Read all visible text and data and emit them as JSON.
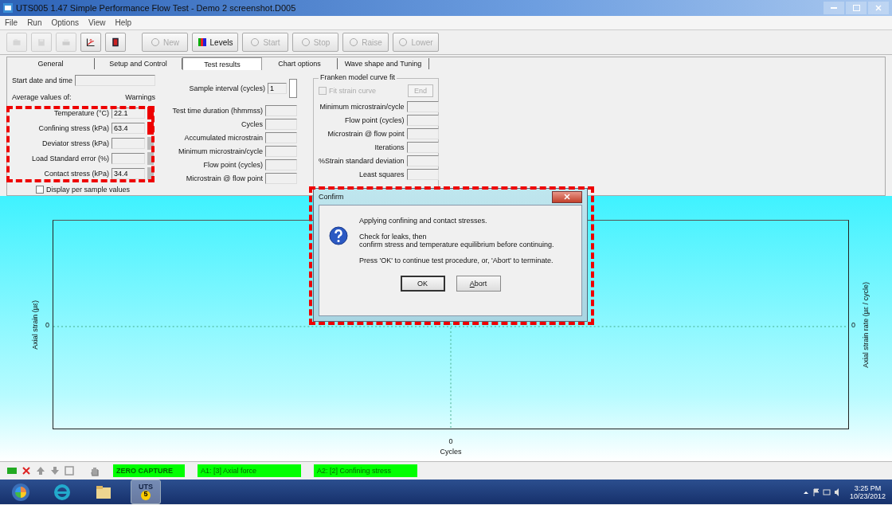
{
  "window": {
    "title": "UTS005 1.47 Simple Performance Flow Test - Demo 2 screenshot.D005"
  },
  "menu": [
    "File",
    "Run",
    "Options",
    "View",
    "Help"
  ],
  "toolbar": {
    "icon_buttons": [
      {
        "disabled": true
      },
      {
        "disabled": true
      },
      {
        "disabled": true
      },
      {
        "disabled": false
      },
      {
        "disabled": false
      }
    ],
    "text_buttons": [
      {
        "label": "New",
        "disabled": true
      },
      {
        "label": "Levels",
        "disabled": false
      },
      {
        "label": "Start",
        "disabled": true
      },
      {
        "label": "Stop",
        "disabled": true
      },
      {
        "label": "Raise",
        "disabled": true
      },
      {
        "label": "Lower",
        "disabled": true
      }
    ]
  },
  "tabs": [
    {
      "label": "General",
      "selected": false
    },
    {
      "label": "Setup and Control",
      "selected": false
    },
    {
      "label": "Test results",
      "selected": true
    },
    {
      "label": "Chart options",
      "selected": false
    },
    {
      "label": "Wave shape and Tuning",
      "selected": false
    }
  ],
  "test_results": {
    "start_label": "Start date and time",
    "average_label": "Average values of:",
    "warnings_label": "Warnings",
    "averages": [
      {
        "label": "Temperature (°C)",
        "value": "22.1",
        "warning": true
      },
      {
        "label": "Confining stress (kPa)",
        "value": "63.4",
        "warning": true
      },
      {
        "label": "Deviator stress (kPa)",
        "warning": false
      },
      {
        "label": "Load Standard error (%)",
        "warning": false
      },
      {
        "label": "Contact stress (kPa)",
        "value": "34.4",
        "warning": false
      }
    ],
    "per_sample": {
      "label": "Display per sample values",
      "checked": false
    },
    "sample_interval": {
      "label": "Sample interval (cycles)",
      "value": "1"
    },
    "results": [
      "Test time duration (hhmmss)",
      "Cycles",
      "Accumulated microstrain",
      "Minimum microstrain/cycle",
      "Flow point (cycles)",
      "Microstrain @ flow point"
    ],
    "franken": {
      "title": "Franken model curve fit",
      "fit": {
        "label": "Fit strain curve",
        "checked": false,
        "disabled": true
      },
      "end": {
        "label": "End",
        "disabled": true
      },
      "rows": [
        "Minimum microstrain/cycle",
        "Flow point (cycles)",
        "Microstrain @ flow point",
        "Iterations",
        "%Strain standard deviation",
        "Least squares"
      ]
    }
  },
  "chart": {
    "ylabel": "Axial strain (µε)",
    "y2label": "Axial strain rate (µε / cycle)",
    "y_tick": "0",
    "y2_tick": "0",
    "x_tick": "0",
    "xlabel": "Cycles"
  },
  "dialog": {
    "title": "Confirm",
    "paragraphs": [
      [
        "Applying confining and contact stresses."
      ],
      [
        "Check for leaks, then",
        "confirm stress and temperature equilibrium before continuing."
      ],
      [
        "Press 'OK' to continue test procedure, or, 'Abort' to terminate."
      ]
    ],
    "buttons": [
      {
        "label": "OK",
        "default": true,
        "access_key": false
      },
      {
        "label": "Abort",
        "default": false,
        "access_key": true
      }
    ]
  },
  "status_bar": {
    "zero": "ZERO CAPTURE",
    "channels": [
      "A1: [3] Axial force",
      "A2: [2] Confining stress"
    ]
  },
  "taskbar": {
    "apps": [
      {
        "selected": false
      },
      {
        "selected": false
      },
      {
        "selected": false
      },
      {
        "selected": true
      }
    ],
    "app_badge": "UTS",
    "app_badge_number": "5",
    "time": "3:25 PM",
    "date": "10/23/2012"
  }
}
